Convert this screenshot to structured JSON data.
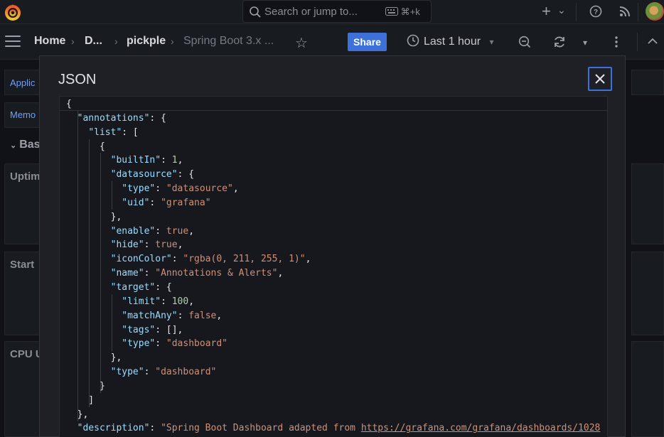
{
  "topbar": {
    "search_placeholder": "Search or jump to...",
    "search_shortcut": "⌘+k",
    "plus_icon": "+",
    "chevron": "⌄"
  },
  "navbar": {
    "crumb_home": "Home",
    "crumb_d": "D...",
    "crumb_pickple": "pickple",
    "crumb_dashboard": "Spring Boot 3.x ...",
    "share_label": "Share",
    "time_range": "Last 1 hour"
  },
  "background": {
    "link1": "Applic",
    "link2": "Memo",
    "row_title": "Bas",
    "panel1": "Uptim",
    "panel2": "Start",
    "panel3": "CPU U"
  },
  "modal": {
    "title": "JSON",
    "json_lines": [
      [
        {
          "t": "p",
          "v": "{"
        }
      ],
      [
        {
          "t": "p",
          "v": "  "
        },
        {
          "t": "k",
          "v": "\"annotations\""
        },
        {
          "t": "p",
          "v": ": {"
        }
      ],
      [
        {
          "t": "p",
          "v": "    "
        },
        {
          "t": "k",
          "v": "\"list\""
        },
        {
          "t": "p",
          "v": ": ["
        }
      ],
      [
        {
          "t": "p",
          "v": "      {"
        }
      ],
      [
        {
          "t": "p",
          "v": "        "
        },
        {
          "t": "k",
          "v": "\"builtIn\""
        },
        {
          "t": "p",
          "v": ": "
        },
        {
          "t": "n",
          "v": "1"
        },
        {
          "t": "p",
          "v": ","
        }
      ],
      [
        {
          "t": "p",
          "v": "        "
        },
        {
          "t": "k",
          "v": "\"datasource\""
        },
        {
          "t": "p",
          "v": ": {"
        }
      ],
      [
        {
          "t": "p",
          "v": "          "
        },
        {
          "t": "k",
          "v": "\"type\""
        },
        {
          "t": "p",
          "v": ": "
        },
        {
          "t": "s",
          "v": "\"datasource\""
        },
        {
          "t": "p",
          "v": ","
        }
      ],
      [
        {
          "t": "p",
          "v": "          "
        },
        {
          "t": "k",
          "v": "\"uid\""
        },
        {
          "t": "p",
          "v": ": "
        },
        {
          "t": "s",
          "v": "\"grafana\""
        }
      ],
      [
        {
          "t": "p",
          "v": "        },"
        }
      ],
      [
        {
          "t": "p",
          "v": "        "
        },
        {
          "t": "k",
          "v": "\"enable\""
        },
        {
          "t": "p",
          "v": ": "
        },
        {
          "t": "b",
          "v": "true"
        },
        {
          "t": "p",
          "v": ","
        }
      ],
      [
        {
          "t": "p",
          "v": "        "
        },
        {
          "t": "k",
          "v": "\"hide\""
        },
        {
          "t": "p",
          "v": ": "
        },
        {
          "t": "b",
          "v": "true"
        },
        {
          "t": "p",
          "v": ","
        }
      ],
      [
        {
          "t": "p",
          "v": "        "
        },
        {
          "t": "k",
          "v": "\"iconColor\""
        },
        {
          "t": "p",
          "v": ": "
        },
        {
          "t": "s",
          "v": "\"rgba(0, 211, 255, 1)\""
        },
        {
          "t": "p",
          "v": ","
        }
      ],
      [
        {
          "t": "p",
          "v": "        "
        },
        {
          "t": "k",
          "v": "\"name\""
        },
        {
          "t": "p",
          "v": ": "
        },
        {
          "t": "s",
          "v": "\"Annotations & Alerts\""
        },
        {
          "t": "p",
          "v": ","
        }
      ],
      [
        {
          "t": "p",
          "v": "        "
        },
        {
          "t": "k",
          "v": "\"target\""
        },
        {
          "t": "p",
          "v": ": {"
        }
      ],
      [
        {
          "t": "p",
          "v": "          "
        },
        {
          "t": "k",
          "v": "\"limit\""
        },
        {
          "t": "p",
          "v": ": "
        },
        {
          "t": "n",
          "v": "100"
        },
        {
          "t": "p",
          "v": ","
        }
      ],
      [
        {
          "t": "p",
          "v": "          "
        },
        {
          "t": "k",
          "v": "\"matchAny\""
        },
        {
          "t": "p",
          "v": ": "
        },
        {
          "t": "b",
          "v": "false"
        },
        {
          "t": "p",
          "v": ","
        }
      ],
      [
        {
          "t": "p",
          "v": "          "
        },
        {
          "t": "k",
          "v": "\"tags\""
        },
        {
          "t": "p",
          "v": ": [],"
        }
      ],
      [
        {
          "t": "p",
          "v": "          "
        },
        {
          "t": "k",
          "v": "\"type\""
        },
        {
          "t": "p",
          "v": ": "
        },
        {
          "t": "s",
          "v": "\"dashboard\""
        }
      ],
      [
        {
          "t": "p",
          "v": "        },"
        }
      ],
      [
        {
          "t": "p",
          "v": "        "
        },
        {
          "t": "k",
          "v": "\"type\""
        },
        {
          "t": "p",
          "v": ": "
        },
        {
          "t": "s",
          "v": "\"dashboard\""
        }
      ],
      [
        {
          "t": "p",
          "v": "      }"
        }
      ],
      [
        {
          "t": "p",
          "v": "    ]"
        }
      ],
      [
        {
          "t": "p",
          "v": "  },"
        }
      ],
      [
        {
          "t": "p",
          "v": "  "
        },
        {
          "t": "k",
          "v": "\"description\""
        },
        {
          "t": "p",
          "v": ": "
        },
        {
          "t": "s",
          "v": "\"Spring Boot Dashboard adapted from "
        },
        {
          "t": "u",
          "v": "https://grafana.com/grafana/dashboards/1028"
        }
      ]
    ]
  },
  "colors": {
    "accent": "#3d71d9",
    "json_key": "#9cdcfe",
    "json_string": "#ce9178",
    "json_number": "#b5cea8"
  }
}
